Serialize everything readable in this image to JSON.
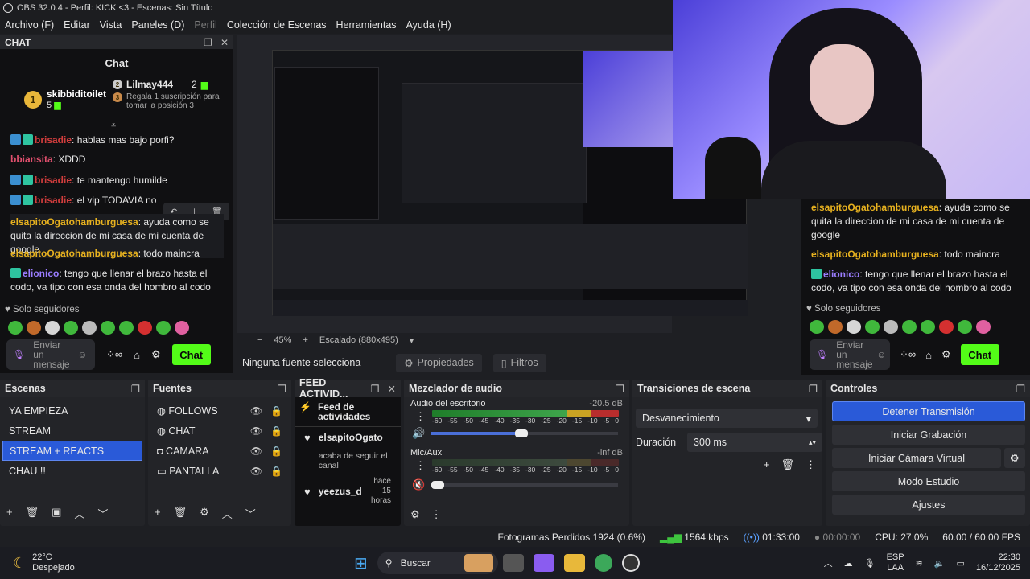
{
  "window": {
    "title": "OBS 32.0.4 - Perfil: KICK <3 - Escenas: Sin Título"
  },
  "menu": [
    "Archivo (F)",
    "Editar",
    "Vista",
    "Paneles (D)",
    "Perfil",
    "Colección de Escenas",
    "Herramientas",
    "Ayuda (H)"
  ],
  "chat": {
    "dock_title": "CHAT",
    "title": "Chat",
    "leaderboard": [
      {
        "rank": "1",
        "name": "skibbiditoilet",
        "gifts": "5"
      },
      {
        "rank": "2",
        "name": "Lilmay444",
        "gifts": "2"
      },
      {
        "rank": "3",
        "text": "Regala 1 suscripción para tomar la posición 3"
      }
    ],
    "messages": [
      {
        "user": "brisadie",
        "text": ": hablas mas bajo porfi?"
      },
      {
        "user": "bbiansita",
        "text": ": XDDD"
      },
      {
        "user": "brisadie",
        "text": ": te mantengo humilde"
      },
      {
        "user": "brisadie",
        "text": ": el vip TODAVIA no"
      },
      {
        "user": "elsapitoOgatohamburguesa",
        "text": ": ayuda como se quita la direccion de mi casa de mi cuenta de google"
      },
      {
        "user": "elsapitoOgatohamburguesa",
        "text": ": todo maincra"
      },
      {
        "user": "elionico",
        "text": ": tengo que llenar el brazo hasta el codo, va tipo con esa onda del hombro al codo"
      }
    ],
    "followers_only": "Solo seguidores",
    "input_placeholder": "Enviar un mensaje",
    "send_label": "Chat"
  },
  "right_chat": {
    "messages": [
      {
        "user": "elsapitoOgatohamburguesa",
        "text": ": ayuda como se quita la direccion de mi casa de mi cuenta de google"
      },
      {
        "user": "elsapitoOgatohamburguesa",
        "text": ": todo maincra"
      },
      {
        "user": "elionico",
        "text": ": tengo que llenar el brazo hasta el codo, va tipo con esa onda del hombro al codo"
      }
    ],
    "followers_only": "Solo seguidores",
    "input_placeholder": "Enviar un mensaje",
    "send_label": "Chat"
  },
  "preview": {
    "zoom": "45%",
    "scale": "Escalado (880x495)"
  },
  "source_toolbar": {
    "no_source": "Ninguna fuente selecciona",
    "properties": "Propiedades",
    "filters": "Filtros"
  },
  "scenes": {
    "title": "Escenas",
    "items": [
      "YA EMPIEZA",
      "STREAM",
      "STREAM + REACTS",
      "CHAU !!"
    ],
    "selected": 2
  },
  "sources": {
    "title": "Fuentes",
    "items": [
      {
        "name": "FOLLOWS",
        "icon": "globe-icon"
      },
      {
        "name": "CHAT",
        "icon": "globe-icon"
      },
      {
        "name": "CAMARA",
        "icon": "camera-icon"
      },
      {
        "name": "PANTALLA",
        "icon": "monitor-icon"
      }
    ]
  },
  "activity": {
    "title": "FEED ACTIVID...",
    "header": "Feed de actividades",
    "items": [
      {
        "user": "elsapitoOgato",
        "text": "acaba de seguir el canal",
        "time": ""
      },
      {
        "user": "yeezus_d",
        "text": "",
        "time": "hace 15 horas"
      }
    ]
  },
  "mixer": {
    "title": "Mezclador de audio",
    "tracks": [
      {
        "name": "Audio del escritorio",
        "db": "-20.5 dB",
        "level": 0.85
      },
      {
        "name": "Mic/Aux",
        "db": "-inf dB",
        "level": 0.0
      }
    ],
    "ticks": [
      "-60",
      "-55",
      "-50",
      "-45",
      "-40",
      "-35",
      "-30",
      "-25",
      "-20",
      "-15",
      "-10",
      "-5",
      "0"
    ]
  },
  "transitions": {
    "title": "Transiciones de escena",
    "selected": "Desvanecimiento",
    "duration_label": "Duración",
    "duration": "300 ms"
  },
  "controls": {
    "title": "Controles",
    "buttons": [
      "Detener Transmisión",
      "Iniciar Grabación",
      "Iniciar Cámara Virtual",
      "Modo Estudio",
      "Ajustes"
    ]
  },
  "status": {
    "dropped": "Fotogramas Perdidos 1924 (0.6%)",
    "kbps": "1564 kbps",
    "stream_time": "01:33:00",
    "rec_time": "00:00:00",
    "cpu": "CPU: 27.0%",
    "fps": "60.00 / 60.00 FPS"
  },
  "taskbar": {
    "temp": "22°C",
    "weather": "Despejado",
    "search": "Buscar",
    "lang1": "ESP",
    "lang2": "LAA",
    "time": "22:30",
    "date": "16/12/2025"
  },
  "colors": {
    "accent": "#2a5ad8",
    "kick_green": "#53fc18"
  }
}
